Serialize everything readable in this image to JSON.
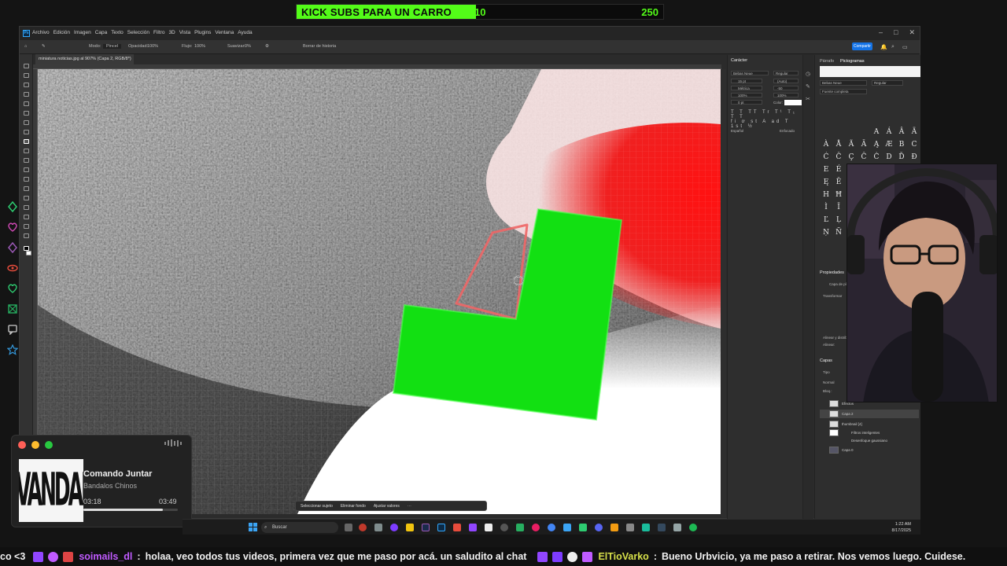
{
  "kick_goal": {
    "label": "KICK SUBS PARA UN CARRO",
    "current": "10",
    "goal": "250",
    "progress_fraction": 0.49,
    "color": "#53fc18"
  },
  "photoshop": {
    "menu": [
      "Archivo",
      "Edición",
      "Imagen",
      "Capa",
      "Texto",
      "Selección",
      "Filtro",
      "3D",
      "Vista",
      "Plugins",
      "Ventana",
      "Ayuda"
    ],
    "options": {
      "mode_label": "Modo:",
      "mode_value": "Pincel",
      "opacity_label": "Opacidad:",
      "opacity_value": "100%",
      "flow_label": "Flujo:",
      "flow_value": "100%",
      "smooth_label": "Suavizar:",
      "smooth_value": "0%",
      "history_label": "Borrar de historia",
      "share_label": "Compartir"
    },
    "document_tab": "miniatura noticias.jpg al 907% (Capa 2, RGB/8*) *",
    "context_bar": {
      "select_subject": "Seleccionar sujeto",
      "remove_bg": "Eliminar fondo",
      "adjust": "Ajustar valores"
    },
    "character_panel": {
      "title": "Carácter",
      "font": "Bebas Neue",
      "style": "Regular",
      "size": "15 pt",
      "leading": "(Auto)",
      "kerning": "Métrica",
      "tracking": "-50",
      "scale_v": "100%",
      "scale_h": "100%",
      "baseline": "0 pt",
      "color_label": "Color:",
      "language": "Español",
      "antialias": "Enfocado"
    },
    "glyphs_panel": {
      "tab1": "Párrafo",
      "tab2": "Pictogramas",
      "font": "Bebas Neue",
      "style": "Regular",
      "filter": "Fuente completa",
      "glyphs": [
        "",
        "",
        "",
        "",
        "A",
        "Á",
        "Â",
        "Ä",
        "À",
        "Å",
        "Ã",
        "Ā",
        "Ą",
        "Æ",
        "B",
        "C",
        "Ć",
        "Č",
        "Ç",
        "Ĉ",
        "Ċ",
        "D",
        "Ď",
        "Đ",
        "E",
        "É",
        "Ê",
        "Ě",
        "Ë",
        "Ė",
        "È",
        "Ē",
        "Ę",
        "Ẽ",
        "F",
        "G",
        "Ğ",
        "Ĝ",
        "Ģ",
        "Ġ",
        "H",
        "Ħ",
        "Ĥ",
        "I",
        "Í",
        "Î",
        "Ï",
        "İ",
        "Ì",
        "Ī",
        "Į",
        "J",
        "K",
        "Ķ",
        "L",
        "Ĺ",
        "Ľ",
        "Ļ",
        "Ŀ",
        "Ł",
        "M",
        "N",
        "Ń",
        "Ň",
        "Ņ",
        "Ñ"
      ],
      "properties_title": "Propiedades",
      "layer_label": "Capa de píxeles",
      "transform_label": "Transformar",
      "align_label": "Alinear y distribuir",
      "align_sub": "Alinear:",
      "layers_title": "Capas",
      "layers_kind": "Tipo",
      "blend_mode": "Normal",
      "lock_label": "Bloq.:",
      "layers": [
        "Efectos",
        "Capa 2",
        "thumbnail [4]",
        "Filtros inteligentes",
        "Desenfoque gaussiano",
        "Capa 0"
      ]
    }
  },
  "music_player": {
    "album_text": "VANDALOS",
    "title": "Comando Juntar",
    "artist": "Bandalos Chinos",
    "current_time": "03:18",
    "total_time": "03:49",
    "progress_fraction": 0.84
  },
  "taskbar": {
    "search_placeholder": "Buscar",
    "time": "1:22 AM",
    "date": "8/17/2025"
  },
  "chat_ticker": {
    "lead_text": "co <3",
    "user1": "soimails_dl",
    "msg1": "holaa, veo todos tus videos, primera vez que me paso por acá. un saludito al chat",
    "user2": "ElTioVarko",
    "msg2": "Bueno Urbvicio, ya me paso a retirar. Nos vemos luego. Cuidese."
  }
}
